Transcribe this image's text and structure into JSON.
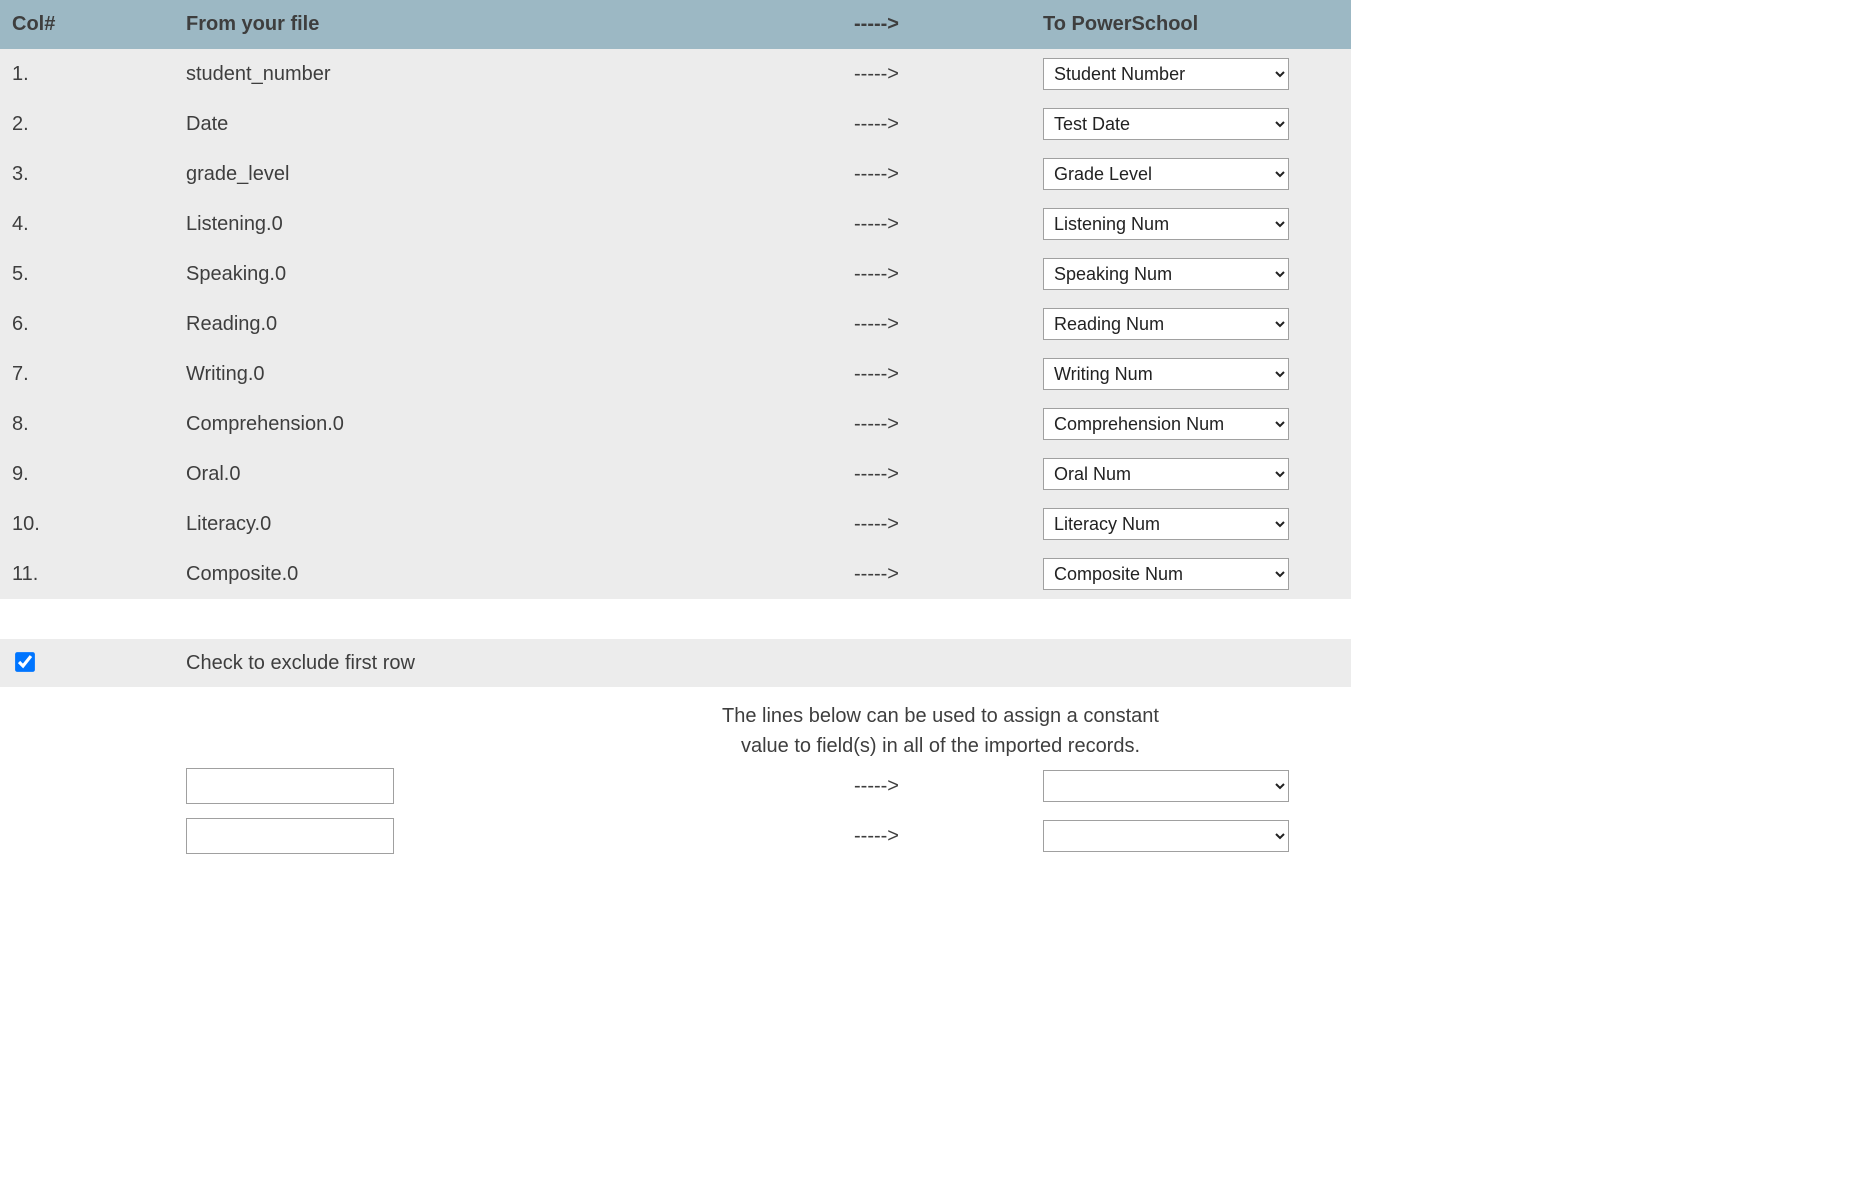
{
  "header": {
    "col": "Col#",
    "from": "From your file",
    "arrow": "----->",
    "to": "To PowerSchool"
  },
  "rows": [
    {
      "n": "1.",
      "from": "student_number",
      "arrow": "----->",
      "to": "Student Number"
    },
    {
      "n": "2.",
      "from": "Date",
      "arrow": "----->",
      "to": "Test Date"
    },
    {
      "n": "3.",
      "from": "grade_level",
      "arrow": "----->",
      "to": "Grade Level"
    },
    {
      "n": "4.",
      "from": "Listening.0",
      "arrow": "----->",
      "to": "Listening Num"
    },
    {
      "n": "5.",
      "from": "Speaking.0",
      "arrow": "----->",
      "to": "Speaking Num"
    },
    {
      "n": "6.",
      "from": "Reading.0",
      "arrow": "----->",
      "to": "Reading Num"
    },
    {
      "n": "7.",
      "from": "Writing.0",
      "arrow": "----->",
      "to": "Writing Num"
    },
    {
      "n": "8.",
      "from": "Comprehension.0",
      "arrow": "----->",
      "to": "Comprehension Num"
    },
    {
      "n": "9.",
      "from": "Oral.0",
      "arrow": "----->",
      "to": "Oral Num"
    },
    {
      "n": "10.",
      "from": "Literacy.0",
      "arrow": "----->",
      "to": "Literacy Num"
    },
    {
      "n": "11.",
      "from": "Composite.0",
      "arrow": "----->",
      "to": "Composite Num"
    }
  ],
  "exclude": {
    "checked": true,
    "label": "Check to exclude first row"
  },
  "hint": {
    "line1": "The lines below can be used to assign a constant",
    "line2": "value to field(s) in all of the imported records."
  },
  "constants": [
    {
      "value": "",
      "arrow": "----->",
      "to": ""
    },
    {
      "value": "",
      "arrow": "----->",
      "to": ""
    }
  ]
}
